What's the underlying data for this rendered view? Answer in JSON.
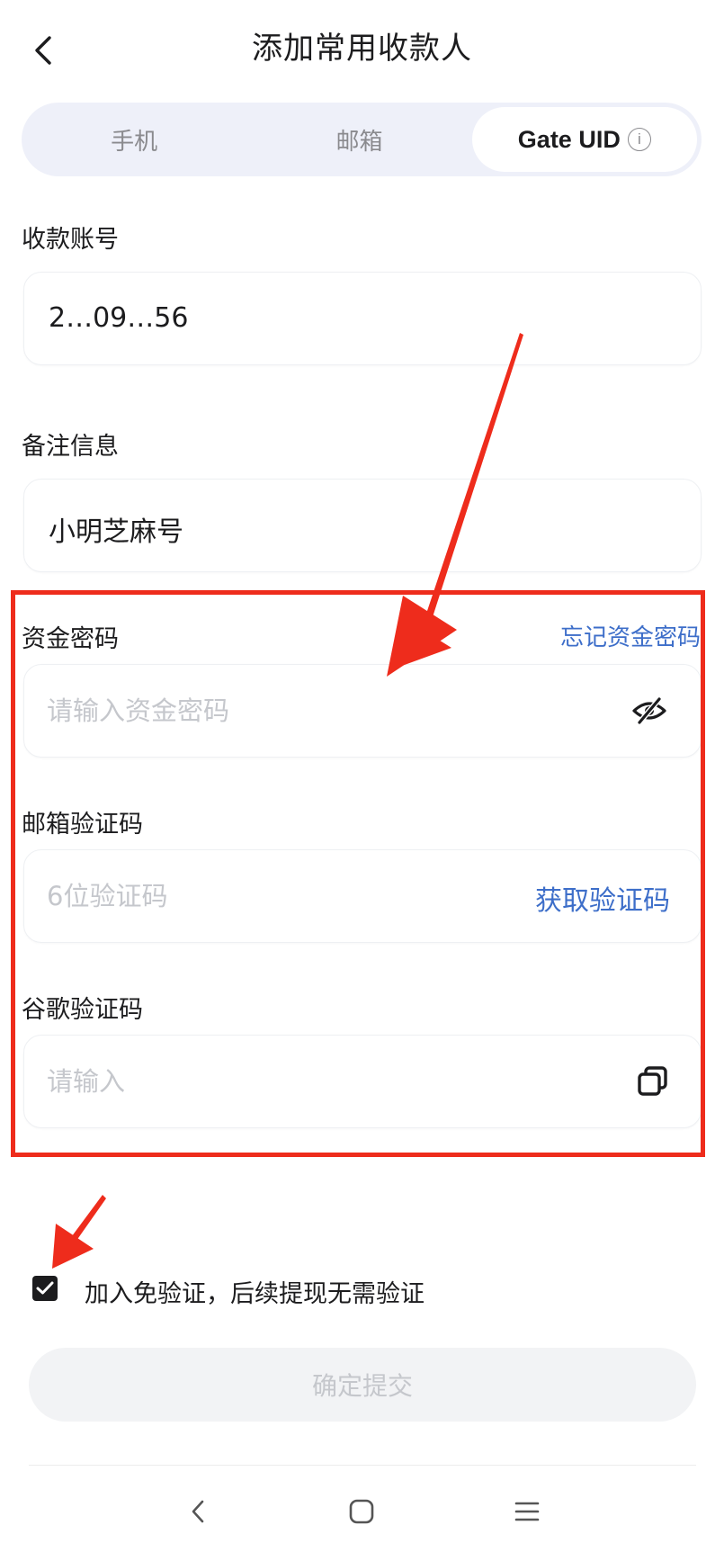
{
  "header": {
    "back_icon": "chevron-left-icon",
    "title": "添加常用收款人"
  },
  "tabs": [
    {
      "label": "手机",
      "active": false
    },
    {
      "label": "邮箱",
      "active": false
    },
    {
      "label": "Gate UID",
      "active": true,
      "icon": "info-icon",
      "icon_glyph": "i"
    }
  ],
  "account": {
    "label": "收款账号",
    "value": "2…09…56"
  },
  "remark": {
    "label": "备注信息",
    "value": "小明芝麻号"
  },
  "fund_password": {
    "label": "资金密码",
    "forgot_link": "忘记资金密码",
    "placeholder": "请输入资金密码",
    "icon": "eye-slash-icon"
  },
  "email_code": {
    "label": "邮箱验证码",
    "placeholder": "6位验证码",
    "get_code": "获取验证码"
  },
  "google_code": {
    "label": "谷歌验证码",
    "placeholder": "请输入",
    "icon": "paste-icon"
  },
  "exempt": {
    "checked": true,
    "text": "加入免验证，后续提现无需验证"
  },
  "submit_label": "确定提交",
  "nav": {
    "back_icon": "nav-back-icon",
    "home_icon": "nav-home-icon",
    "menu_icon": "nav-menu-icon"
  },
  "colors": {
    "accent_blue": "#3d6ec9",
    "highlight_red": "#ee2c1c",
    "tab_bg": "#eef0f9"
  }
}
